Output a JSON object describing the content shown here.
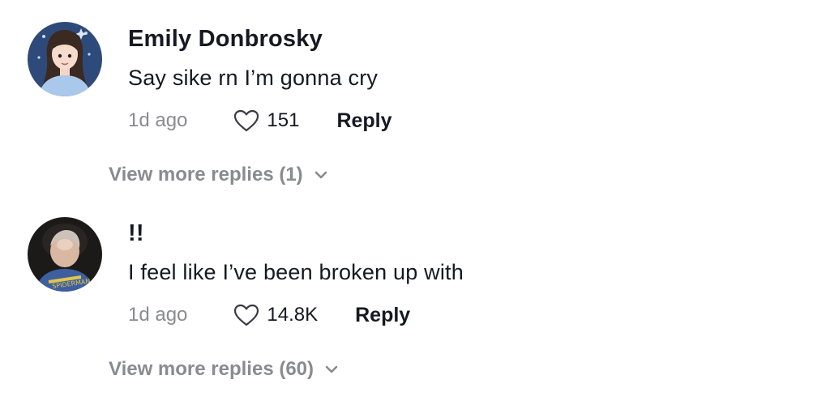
{
  "comments": [
    {
      "username": "Emily Donbrosky",
      "text": "Say sike rn I’m gonna cry",
      "time": "1d ago",
      "likes": "151",
      "reply_label": "Reply",
      "view_more": "View more replies (1)"
    },
    {
      "username": "!!",
      "text": "I feel like I’ve been broken up with",
      "time": "1d ago",
      "likes": "14.8K",
      "reply_label": "Reply",
      "view_more": "View more replies (60)"
    }
  ],
  "icons": {
    "like": "heart-outline-icon",
    "expand": "chevron-down-icon"
  },
  "colors": {
    "text": "#161823",
    "muted": "#8a8b91"
  }
}
